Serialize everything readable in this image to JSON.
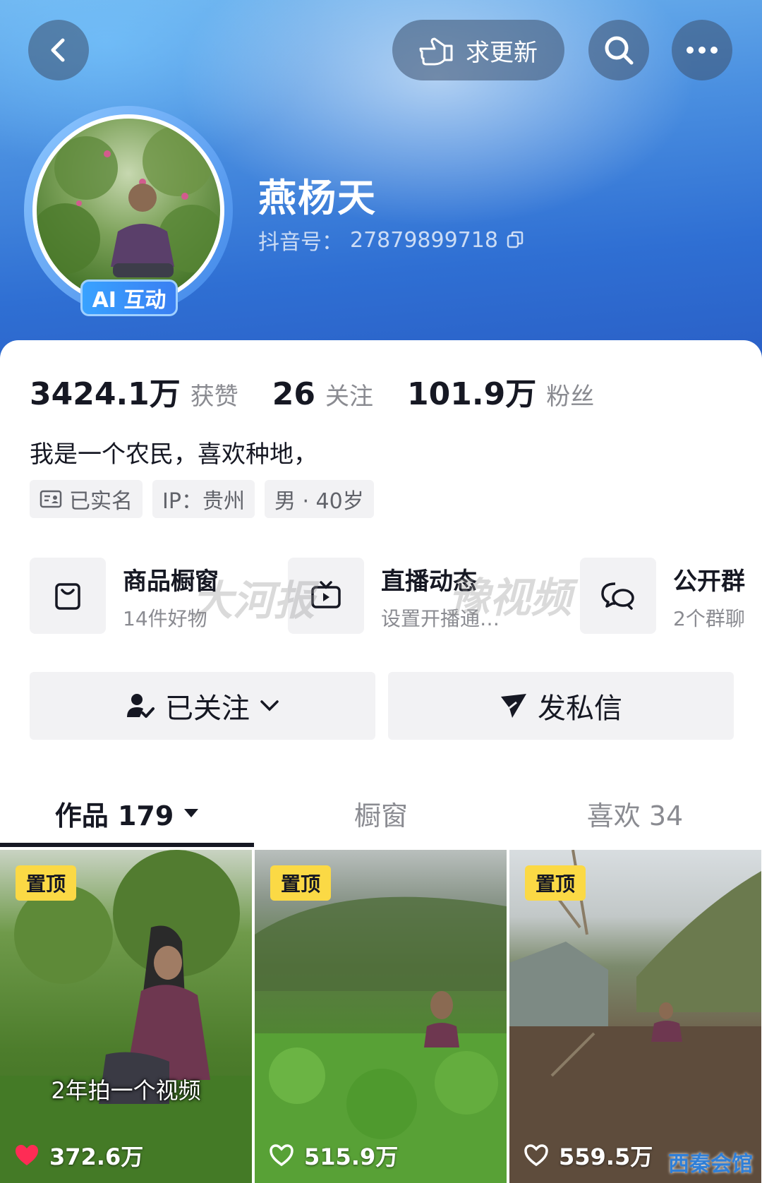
{
  "header": {
    "update_label": "求更新",
    "profile_name": "燕杨天",
    "douyin_id_label": "抖音号：",
    "douyin_id": "27879899718",
    "ai_badge": "AI 互动"
  },
  "stats": [
    {
      "value": "3424.1万",
      "label": "获赞"
    },
    {
      "value": "26",
      "label": "关注"
    },
    {
      "value": "101.9万",
      "label": "粉丝"
    }
  ],
  "bio": "我是一个农民，喜欢种地，",
  "tags": [
    "已实名",
    "IP：贵州",
    "男 · 40岁"
  ],
  "shortcuts": [
    {
      "title": "商品橱窗",
      "sub": "14件好物",
      "icon": "shopping-bag-icon"
    },
    {
      "title": "直播动态",
      "sub": "设置开播通…",
      "icon": "tv-live-icon"
    },
    {
      "title": "公开群",
      "sub": "2个群聊",
      "icon": "chat-bubbles-icon"
    }
  ],
  "actions": {
    "follow": "已关注",
    "message": "发私信"
  },
  "tabs": [
    "作品 179",
    "橱窗",
    "喜欢 34"
  ],
  "videos": [
    {
      "pin": "置顶",
      "likes": "372.6万",
      "caption": "2年拍一个视频",
      "liked": true
    },
    {
      "pin": "置顶",
      "likes": "515.9万",
      "caption": "",
      "liked": false
    },
    {
      "pin": "置顶",
      "likes": "559.5万",
      "caption": "",
      "liked": false
    }
  ],
  "watermarks": {
    "left": "大河报",
    "right": "豫视频",
    "corner": "西秦会馆"
  },
  "colors": {
    "pin_bg": "#fbd945",
    "like_red": "#fe2c55",
    "header_blue": "#3a7ff2"
  }
}
